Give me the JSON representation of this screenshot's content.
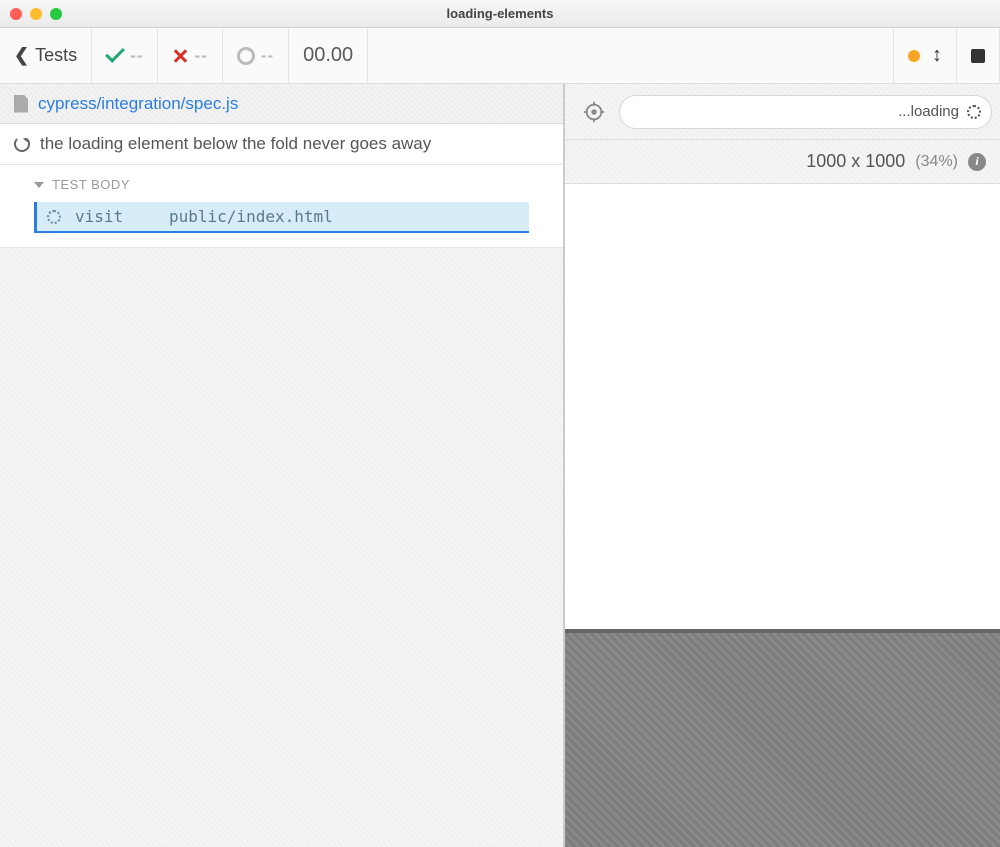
{
  "window": {
    "title": "loading-elements"
  },
  "toolbar": {
    "tests_label": "Tests",
    "pass_count": "--",
    "fail_count": "--",
    "pending_count": "--",
    "timer": "00.00"
  },
  "spec": {
    "path": "cypress/integration/spec.js"
  },
  "test": {
    "title": "the loading element below the fold never goes away",
    "body_label": "TEST BODY",
    "command": {
      "name": "visit",
      "arg": "public/index.html"
    }
  },
  "aut": {
    "url_status": "...loading",
    "viewport": {
      "size": "1000 x 1000",
      "scale": "(34%)"
    }
  }
}
